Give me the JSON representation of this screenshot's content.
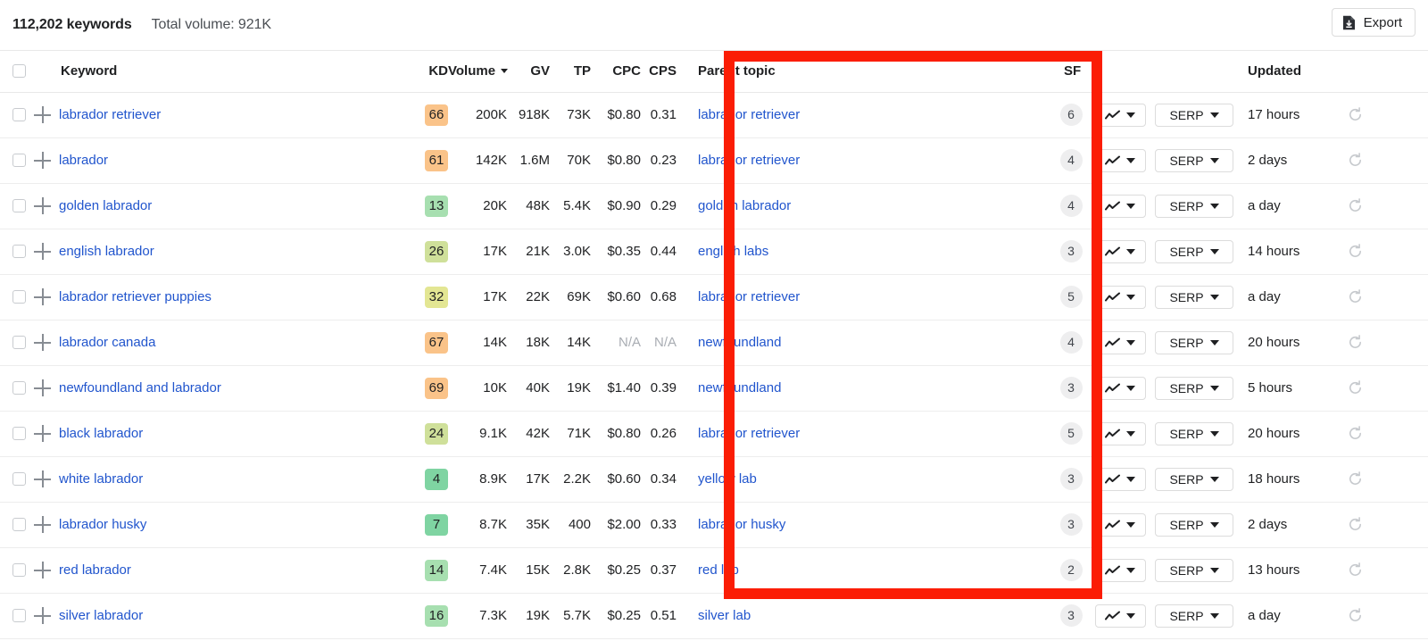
{
  "header": {
    "keywords_count": "112,202 keywords",
    "total_volume": "Total volume: 921K",
    "export_label": "Export"
  },
  "columns": {
    "keyword": "Keyword",
    "kd": "KD",
    "volume": "Volume",
    "gv": "GV",
    "tp": "TP",
    "cpc": "CPC",
    "cps": "CPS",
    "parent_topic": "Parent topic",
    "sf": "SF",
    "updated": "Updated"
  },
  "controls": {
    "chart_button": "",
    "serp_button": "SERP"
  },
  "highlight": {
    "color": "#fb1d05",
    "target_column": "Parent topic"
  },
  "rows": [
    {
      "keyword": "labrador retriever",
      "kd": "66",
      "kd_color": "#fac389",
      "volume": "200K",
      "gv": "918K",
      "tp": "73K",
      "cpc": "$0.80",
      "cps": "0.31",
      "parent_topic": "labrador retriever",
      "sf": "6",
      "serp": "SERP",
      "updated": "17 hours"
    },
    {
      "keyword": "labrador",
      "kd": "61",
      "kd_color": "#fac389",
      "volume": "142K",
      "gv": "1.6M",
      "tp": "70K",
      "cpc": "$0.80",
      "cps": "0.23",
      "parent_topic": "labrador retriever",
      "sf": "4",
      "serp": "SERP",
      "updated": "2 days"
    },
    {
      "keyword": "golden labrador",
      "kd": "13",
      "kd_color": "#a7dfb0",
      "volume": "20K",
      "gv": "48K",
      "tp": "5.4K",
      "cpc": "$0.90",
      "cps": "0.29",
      "parent_topic": "golden labrador",
      "sf": "4",
      "serp": "SERP",
      "updated": "a day"
    },
    {
      "keyword": "english labrador",
      "kd": "26",
      "kd_color": "#cfe09a",
      "volume": "17K",
      "gv": "21K",
      "tp": "3.0K",
      "cpc": "$0.35",
      "cps": "0.44",
      "parent_topic": "english labs",
      "sf": "3",
      "serp": "SERP",
      "updated": "14 hours"
    },
    {
      "keyword": "labrador retriever puppies",
      "kd": "32",
      "kd_color": "#e3e693",
      "volume": "17K",
      "gv": "22K",
      "tp": "69K",
      "cpc": "$0.60",
      "cps": "0.68",
      "parent_topic": "labrador retriever",
      "sf": "5",
      "serp": "SERP",
      "updated": "a day"
    },
    {
      "keyword": "labrador canada",
      "kd": "67",
      "kd_color": "#fac389",
      "volume": "14K",
      "gv": "18K",
      "tp": "14K",
      "cpc": "N/A",
      "cps": "N/A",
      "parent_topic": "newfoundland",
      "sf": "4",
      "serp": "SERP",
      "updated": "20 hours"
    },
    {
      "keyword": "newfoundland and labrador",
      "kd": "69",
      "kd_color": "#fac389",
      "volume": "10K",
      "gv": "40K",
      "tp": "19K",
      "cpc": "$1.40",
      "cps": "0.39",
      "parent_topic": "newfoundland",
      "sf": "3",
      "serp": "SERP",
      "updated": "5 hours"
    },
    {
      "keyword": "black labrador",
      "kd": "24",
      "kd_color": "#cfe09a",
      "volume": "9.1K",
      "gv": "42K",
      "tp": "71K",
      "cpc": "$0.80",
      "cps": "0.26",
      "parent_topic": "labrador retriever",
      "sf": "5",
      "serp": "SERP",
      "updated": "20 hours"
    },
    {
      "keyword": "white labrador",
      "kd": "4",
      "kd_color": "#7fd4a2",
      "volume": "8.9K",
      "gv": "17K",
      "tp": "2.2K",
      "cpc": "$0.60",
      "cps": "0.34",
      "parent_topic": "yellow lab",
      "sf": "3",
      "serp": "SERP",
      "updated": "18 hours"
    },
    {
      "keyword": "labrador husky",
      "kd": "7",
      "kd_color": "#7fd4a2",
      "volume": "8.7K",
      "gv": "35K",
      "tp": "400",
      "cpc": "$2.00",
      "cps": "0.33",
      "parent_topic": "labrador husky",
      "sf": "3",
      "serp": "SERP",
      "updated": "2 days"
    },
    {
      "keyword": "red labrador",
      "kd": "14",
      "kd_color": "#a7dfb0",
      "volume": "7.4K",
      "gv": "15K",
      "tp": "2.8K",
      "cpc": "$0.25",
      "cps": "0.37",
      "parent_topic": "red lab",
      "sf": "2",
      "serp": "SERP",
      "updated": "13 hours"
    },
    {
      "keyword": "silver labrador",
      "kd": "16",
      "kd_color": "#a7dfb0",
      "volume": "7.3K",
      "gv": "19K",
      "tp": "5.7K",
      "cpc": "$0.25",
      "cps": "0.51",
      "parent_topic": "silver lab",
      "sf": "3",
      "serp": "SERP",
      "updated": "a day"
    }
  ]
}
